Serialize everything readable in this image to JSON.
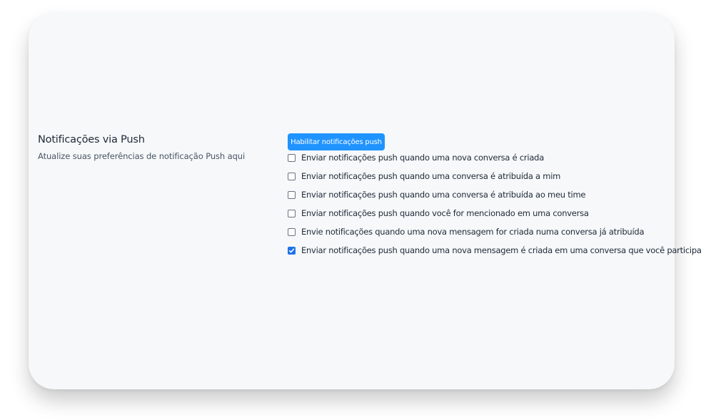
{
  "section": {
    "title": "Notificações via Push",
    "subtitle": "Atualize suas preferências de notificação Push aqui"
  },
  "enable_button": {
    "label": "Habilitar notificações push",
    "color": "#1f93ff"
  },
  "options": [
    {
      "label": "Enviar notificações push quando uma nova conversa é criada",
      "checked": false
    },
    {
      "label": "Enviar notificações push quando uma conversa é atribuída a mim",
      "checked": false
    },
    {
      "label": "Enviar notificações push quando uma conversa é atribuída ao meu time",
      "checked": false
    },
    {
      "label": "Enviar notificações push quando você for mencionado em uma conversa",
      "checked": false
    },
    {
      "label": "Envie notificações quando uma nova mensagem for criada numa conversa já atribuída",
      "checked": false
    },
    {
      "label": "Enviar notificações push quando uma nova mensagem é criada em uma conversa que você participa",
      "checked": true
    }
  ]
}
